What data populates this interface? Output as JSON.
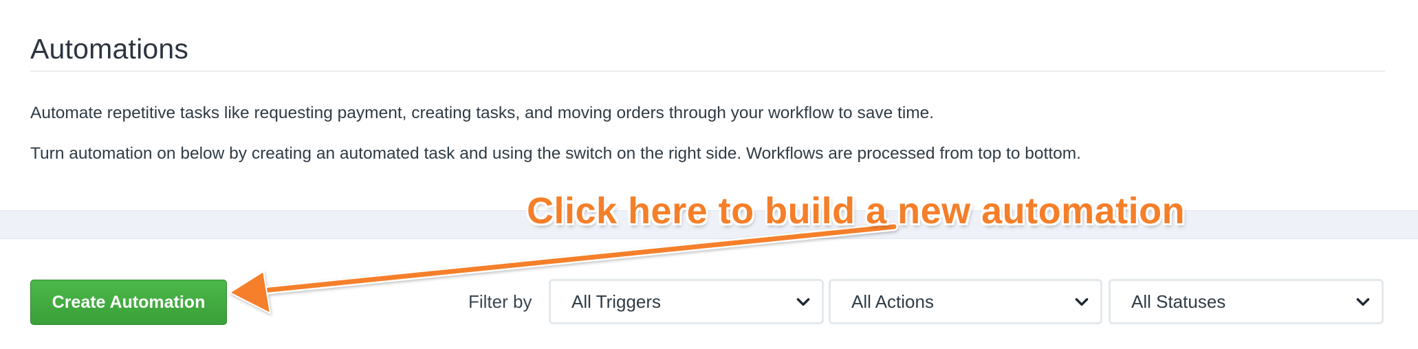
{
  "header": {
    "title": "Automations"
  },
  "description": {
    "line1": "Automate repetitive tasks like requesting payment, creating tasks, and moving orders through your workflow to save time.",
    "line2": "Turn automation on below by creating an automated task and using the switch on the right side. Workflows are processed from top to bottom."
  },
  "toolbar": {
    "create_label": "Create Automation",
    "filter_label": "Filter by",
    "filters": {
      "triggers": "All Triggers",
      "actions": "All Actions",
      "statuses": "All Statuses"
    }
  },
  "annotation": {
    "text": "Click here to build a new automation",
    "color": "#f57f29"
  },
  "colors": {
    "primary_button": "#43ac41",
    "accent_annotation": "#f57f29",
    "band": "#eef1f8"
  },
  "icons": {
    "select_chevron": "chevron-down-icon",
    "annotation_arrow": "arrow-icon"
  }
}
